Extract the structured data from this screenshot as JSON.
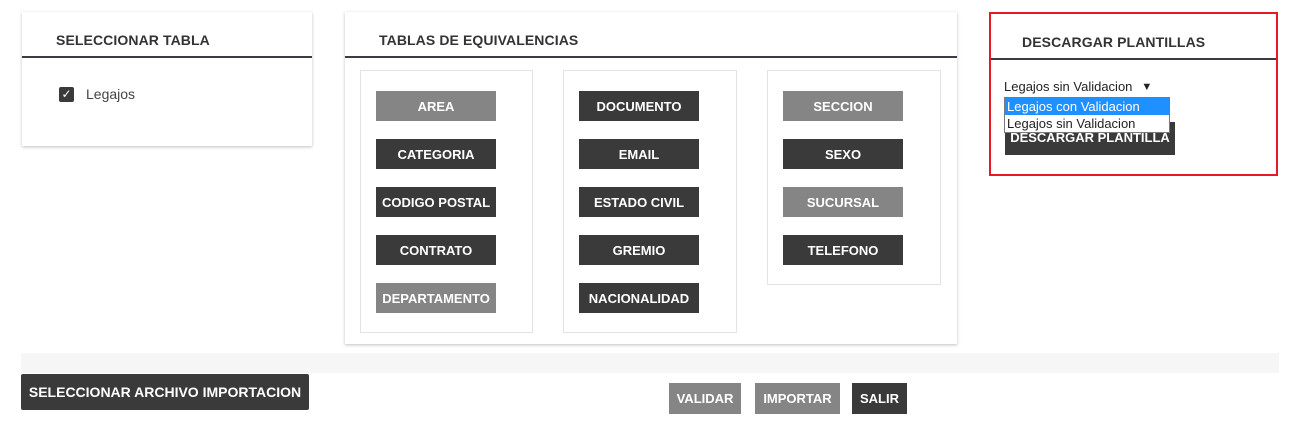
{
  "select_panel": {
    "title": "SELECCIONAR TABLA",
    "checkbox_label": "Legajos",
    "checked": true
  },
  "equiv_panel": {
    "title": "TABLAS DE EQUIVALENCIAS",
    "columns": [
      [
        {
          "label": "AREA",
          "style": "gray"
        },
        {
          "label": "CATEGORIA",
          "style": "dark"
        },
        {
          "label": "CODIGO POSTAL",
          "style": "dark"
        },
        {
          "label": "CONTRATO",
          "style": "dark"
        },
        {
          "label": "DEPARTAMENTO",
          "style": "gray"
        }
      ],
      [
        {
          "label": "DOCUMENTO",
          "style": "dark"
        },
        {
          "label": "EMAIL",
          "style": "dark"
        },
        {
          "label": "ESTADO CIVIL",
          "style": "dark"
        },
        {
          "label": "GREMIO",
          "style": "dark"
        },
        {
          "label": "NACIONALIDAD",
          "style": "dark"
        }
      ],
      [
        {
          "label": "SECCION",
          "style": "gray"
        },
        {
          "label": "SEXO",
          "style": "dark"
        },
        {
          "label": "SUCURSAL",
          "style": "gray"
        },
        {
          "label": "TELEFONO",
          "style": "dark"
        }
      ]
    ]
  },
  "download_panel": {
    "title": "DESCARGAR PLANTILLAS",
    "selected_value": "Legajos sin Validacion",
    "options": [
      "Legajos con Validacion",
      "Legajos sin Validacion"
    ],
    "highlighted_option": "Legajos con Validacion",
    "button_label": "DESCARGAR PLANTILLA"
  },
  "footer": {
    "select_file_label": "SELECCIONAR ARCHIVO IMPORTACION",
    "validate_label": "VALIDAR",
    "import_label": "IMPORTAR",
    "exit_label": "SALIR"
  },
  "colors": {
    "dark_button": "#3a3a3a",
    "gray_button": "#858585",
    "highlight_border": "#e21b26",
    "dropdown_selected": "#1e90ff"
  },
  "icons": {
    "checkbox": "check-icon",
    "select_arrow": "triangle-down-icon"
  }
}
